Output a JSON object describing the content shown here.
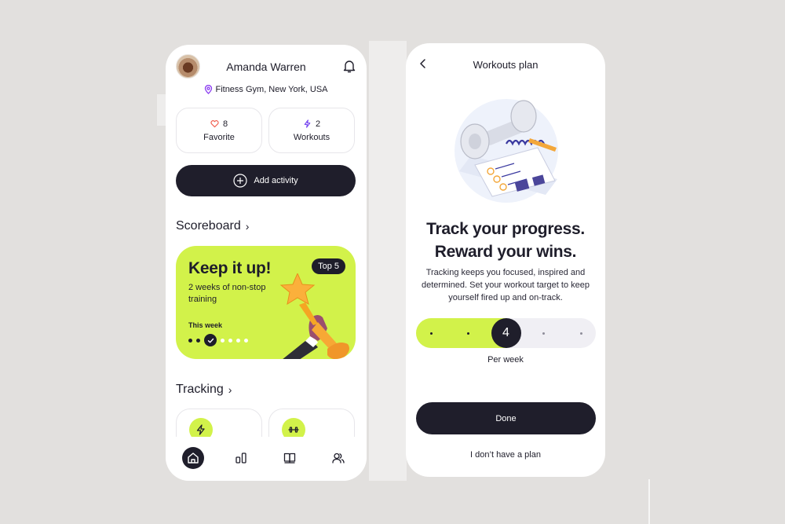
{
  "profile_screen": {
    "user_name": "Amanda Warren",
    "location": "Fitness Gym, New York, USA",
    "stats": [
      {
        "icon": "heart-icon",
        "count": "8",
        "label": "Favorite"
      },
      {
        "icon": "lightning-icon",
        "count": "2",
        "label": "Workouts"
      }
    ],
    "add_activity_label": "Add activity",
    "scoreboard": {
      "section_title": "Scoreboard",
      "card_title": "Keep it up!",
      "card_subtitle": "2 weeks of non-stop training",
      "badge": "Top 5",
      "week_label": "This week",
      "week_days_completed": 2,
      "week_current_day": 3,
      "week_total_days": 7
    },
    "tracking": {
      "section_title": "Tracking",
      "cards": [
        {
          "icon": "lightning-icon"
        },
        {
          "icon": "dumbbell-icon"
        }
      ]
    },
    "tabbar": [
      {
        "name": "home",
        "icon": "home-icon",
        "active": true
      },
      {
        "name": "stats",
        "icon": "bar-chart-icon",
        "active": false
      },
      {
        "name": "library",
        "icon": "book-icon",
        "active": false
      },
      {
        "name": "community",
        "icon": "users-icon",
        "active": false
      }
    ]
  },
  "plan_screen": {
    "title": "Workouts plan",
    "headline_line1": "Track your progress.",
    "headline_line2": "Reward your wins.",
    "description": "Tracking keeps you focused, inspired and determined. Set your workout target to keep yourself fired up and on-track.",
    "picker": {
      "min": 2,
      "max": 6,
      "selected": 4,
      "unit_label": "Per week"
    },
    "done_label": "Done",
    "no_plan_label": "I don’t have a plan"
  },
  "colors": {
    "accent_lime": "#d2f24a",
    "dark": "#1f1e2b",
    "background": "#e2e0de",
    "heart": "#f05a4a",
    "lightning": "#7b4cf0",
    "location_pin": "#8a3cf0"
  }
}
